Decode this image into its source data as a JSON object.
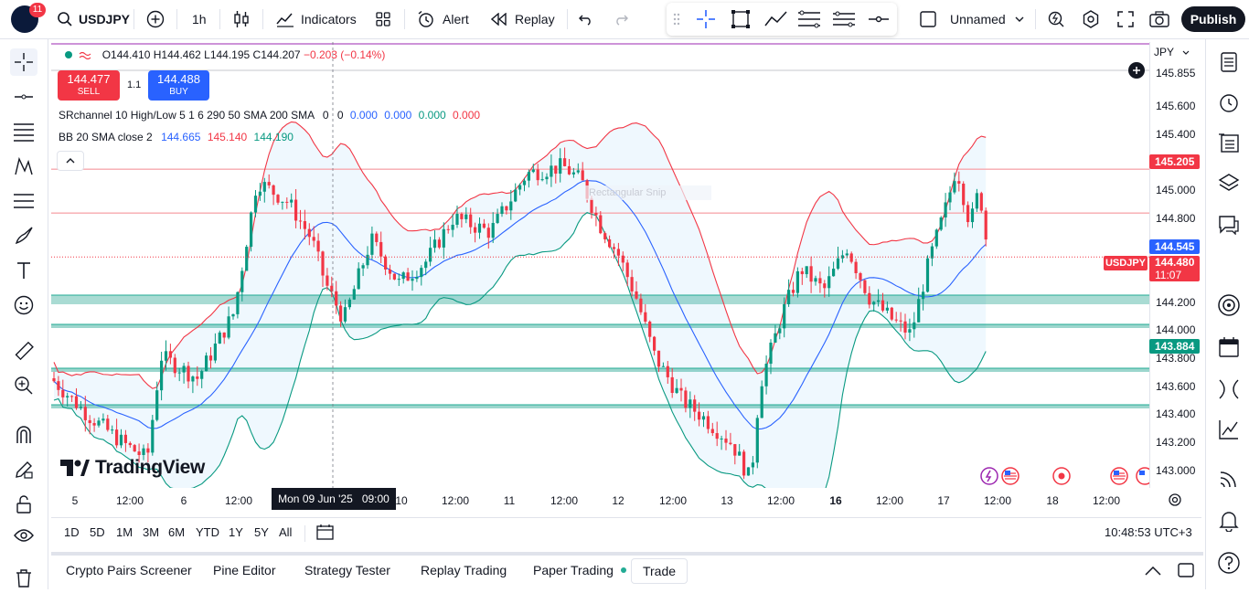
{
  "header": {
    "notif_count": "11",
    "symbol": "USDJPY",
    "interval": "1h",
    "indicators": "Indicators",
    "alert": "Alert",
    "replay": "Replay",
    "layout_name": "Unnamed",
    "publish": "Publish"
  },
  "legend": {
    "ohlc_o": "O144.410",
    "ohlc_h": "H144.462",
    "ohlc_l": "L144.195",
    "ohlc_c": "C144.207",
    "ohlc_chg": "−0.203 (−0.14%)",
    "sell_price": "144.477",
    "sell_label": "SELL",
    "spread": "1.1",
    "buy_price": "144.488",
    "buy_label": "BUY",
    "sr_name": "SRchannel 10 High/Low 5 1 6 290 50 SMA 200 SMA",
    "sr_zero1": "0",
    "sr_zero2": "0",
    "sr_v1": "0.000",
    "sr_v2": "0.000",
    "sr_v3": "0.000",
    "sr_v4": "0.000",
    "bb_name": "BB 20 SMA close 2",
    "bb_basis": "144.665",
    "bb_upper": "145.140",
    "bb_lower": "144.190",
    "watermark": "TradingView",
    "drawing_text": "Rectangular Snip"
  },
  "price_scale": {
    "currency": "JPY",
    "ticks": [
      "145.855",
      "145.600",
      "145.400",
      "145.000",
      "144.800",
      "144.200",
      "144.000",
      "143.800",
      "143.600",
      "143.400",
      "143.200",
      "143.000"
    ],
    "tag_resistance": "145.205",
    "tag_upper": "144.545",
    "tag_symbol": "USDJPY",
    "tag_price": "144.480",
    "tag_countdown": "11:07",
    "tag_support": "143.884",
    "colors": {
      "resistance": "#f23645",
      "basis": "#2962ff",
      "price": "#f23645",
      "support": "#089981"
    }
  },
  "time_scale": {
    "labels": [
      "5",
      "12:00",
      "6",
      "12:00",
      "10",
      "12:00",
      "11",
      "12:00",
      "12",
      "12:00",
      "13",
      "12:00",
      "16",
      "12:00",
      "17",
      "12:00",
      "18",
      "12:00"
    ],
    "cursor_label": "Mon 09 Jun '25   09:00"
  },
  "range_bar": {
    "ranges": [
      "1D",
      "5D",
      "1M",
      "3M",
      "6M",
      "YTD",
      "1Y",
      "5Y",
      "All"
    ],
    "clock": "10:48:53 UTC+3"
  },
  "bottom_tabs": [
    "Crypto Pairs Screener",
    "Pine Editor",
    "Strategy Tester",
    "Replay Trading",
    "Paper Trading",
    "Trade"
  ],
  "chart_data": {
    "type": "candlestick",
    "symbol": "USDJPY",
    "interval": "1h",
    "ylim": [
      142.9,
      145.95
    ],
    "x_labels": [
      "5",
      "12:00",
      "6",
      "12:00",
      "10",
      "12:00",
      "11",
      "12:00",
      "12",
      "12:00",
      "13",
      "12:00",
      "16",
      "12:00",
      "17",
      "12:00",
      "18",
      "12:00"
    ],
    "series": [
      {
        "name": "BB 20 SMA close 2",
        "values_basis_last": 144.665,
        "values_upper_last": 145.14,
        "values_lower_last": 144.19
      }
    ],
    "last_price": 144.48,
    "support_levels": [
      144.2,
      144.0,
      143.7,
      143.45
    ],
    "resistance_levels": [
      145.08,
      144.78
    ]
  }
}
